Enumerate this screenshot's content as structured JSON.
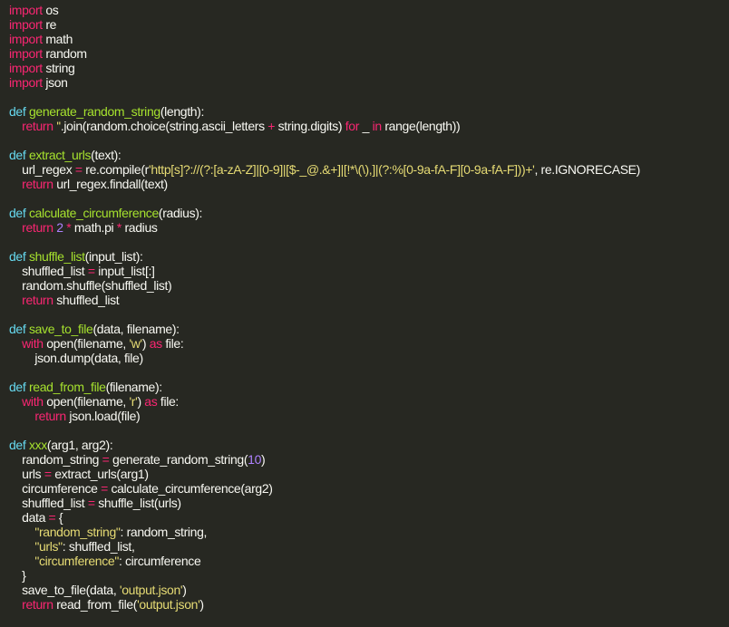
{
  "theme": {
    "background": "#272822",
    "text": "#f8f8f2",
    "keyword": "#f92672",
    "builtin": "#66d9ef",
    "function": "#a6e22e",
    "string": "#e6db74",
    "number": "#ae81ff"
  },
  "code": {
    "lines": [
      [
        [
          "kw",
          "import"
        ],
        [
          "tx",
          " os"
        ]
      ],
      [
        [
          "kw",
          "import"
        ],
        [
          "tx",
          " re"
        ]
      ],
      [
        [
          "kw",
          "import"
        ],
        [
          "tx",
          " math"
        ]
      ],
      [
        [
          "kw",
          "import"
        ],
        [
          "tx",
          " random"
        ]
      ],
      [
        [
          "kw",
          "import"
        ],
        [
          "tx",
          " string"
        ]
      ],
      [
        [
          "kw",
          "import"
        ],
        [
          "tx",
          " json"
        ]
      ],
      [],
      [
        [
          "bi",
          "def"
        ],
        [
          "tx",
          " "
        ],
        [
          "fn",
          "generate_random_string"
        ],
        [
          "tx",
          "(length):"
        ]
      ],
      [
        [
          "tx",
          "    "
        ],
        [
          "kw",
          "return"
        ],
        [
          "tx",
          " "
        ],
        [
          "st",
          "''"
        ],
        [
          "tx",
          ".join(random.choice(string.ascii_letters "
        ],
        [
          "op",
          "+"
        ],
        [
          "tx",
          " string.digits) "
        ],
        [
          "kw",
          "for"
        ],
        [
          "tx",
          " _ "
        ],
        [
          "kw",
          "in"
        ],
        [
          "tx",
          " range(length))"
        ]
      ],
      [],
      [
        [
          "bi",
          "def"
        ],
        [
          "tx",
          " "
        ],
        [
          "fn",
          "extract_urls"
        ],
        [
          "tx",
          "(text):"
        ]
      ],
      [
        [
          "tx",
          "    url_regex "
        ],
        [
          "op",
          "="
        ],
        [
          "tx",
          " re.compile(r"
        ],
        [
          "st",
          "'http[s]?://(?:[a-zA-Z]|[0-9]|[$-_@.&+]|[!*\\(\\),]|(?:%[0-9a-fA-F][0-9a-fA-F]))+'"
        ],
        [
          "tx",
          ", re.IGNORECASE)"
        ]
      ],
      [
        [
          "tx",
          "    "
        ],
        [
          "kw",
          "return"
        ],
        [
          "tx",
          " url_regex.findall(text)"
        ]
      ],
      [],
      [
        [
          "bi",
          "def"
        ],
        [
          "tx",
          " "
        ],
        [
          "fn",
          "calculate_circumference"
        ],
        [
          "tx",
          "(radius):"
        ]
      ],
      [
        [
          "tx",
          "    "
        ],
        [
          "kw",
          "return"
        ],
        [
          "tx",
          " "
        ],
        [
          "nm",
          "2"
        ],
        [
          "tx",
          " "
        ],
        [
          "op",
          "*"
        ],
        [
          "tx",
          " math.pi "
        ],
        [
          "op",
          "*"
        ],
        [
          "tx",
          " radius"
        ]
      ],
      [],
      [
        [
          "bi",
          "def"
        ],
        [
          "tx",
          " "
        ],
        [
          "fn",
          "shuffle_list"
        ],
        [
          "tx",
          "(input_list):"
        ]
      ],
      [
        [
          "tx",
          "    shuffled_list "
        ],
        [
          "op",
          "="
        ],
        [
          "tx",
          " input_list[:]"
        ]
      ],
      [
        [
          "tx",
          "    random.shuffle(shuffled_list)"
        ]
      ],
      [
        [
          "tx",
          "    "
        ],
        [
          "kw",
          "return"
        ],
        [
          "tx",
          " shuffled_list"
        ]
      ],
      [],
      [
        [
          "bi",
          "def"
        ],
        [
          "tx",
          " "
        ],
        [
          "fn",
          "save_to_file"
        ],
        [
          "tx",
          "(data, filename):"
        ]
      ],
      [
        [
          "tx",
          "    "
        ],
        [
          "kw",
          "with"
        ],
        [
          "tx",
          " open(filename, "
        ],
        [
          "st",
          "'w'"
        ],
        [
          "tx",
          ") "
        ],
        [
          "kw",
          "as"
        ],
        [
          "tx",
          " file:"
        ]
      ],
      [
        [
          "tx",
          "        json.dump(data, file)"
        ]
      ],
      [],
      [
        [
          "bi",
          "def"
        ],
        [
          "tx",
          " "
        ],
        [
          "fn",
          "read_from_file"
        ],
        [
          "tx",
          "(filename):"
        ]
      ],
      [
        [
          "tx",
          "    "
        ],
        [
          "kw",
          "with"
        ],
        [
          "tx",
          " open(filename, "
        ],
        [
          "st",
          "'r'"
        ],
        [
          "tx",
          ") "
        ],
        [
          "kw",
          "as"
        ],
        [
          "tx",
          " file:"
        ]
      ],
      [
        [
          "tx",
          "        "
        ],
        [
          "kw",
          "return"
        ],
        [
          "tx",
          " json.load(file)"
        ]
      ],
      [],
      [
        [
          "bi",
          "def"
        ],
        [
          "tx",
          " "
        ],
        [
          "fn",
          "xxx"
        ],
        [
          "tx",
          "(arg1, arg2):"
        ]
      ],
      [
        [
          "tx",
          "    random_string "
        ],
        [
          "op",
          "="
        ],
        [
          "tx",
          " generate_random_string("
        ],
        [
          "nm",
          "10"
        ],
        [
          "tx",
          ")"
        ]
      ],
      [
        [
          "tx",
          "    urls "
        ],
        [
          "op",
          "="
        ],
        [
          "tx",
          " extract_urls(arg1)"
        ]
      ],
      [
        [
          "tx",
          "    circumference "
        ],
        [
          "op",
          "="
        ],
        [
          "tx",
          " calculate_circumference(arg2)"
        ]
      ],
      [
        [
          "tx",
          "    shuffled_list "
        ],
        [
          "op",
          "="
        ],
        [
          "tx",
          " shuffle_list(urls)"
        ]
      ],
      [
        [
          "tx",
          "    data "
        ],
        [
          "op",
          "="
        ],
        [
          "tx",
          " {"
        ]
      ],
      [
        [
          "tx",
          "        "
        ],
        [
          "st",
          "\"random_string\""
        ],
        [
          "tx",
          ": random_string,"
        ]
      ],
      [
        [
          "tx",
          "        "
        ],
        [
          "st",
          "\"urls\""
        ],
        [
          "tx",
          ": shuffled_list,"
        ]
      ],
      [
        [
          "tx",
          "        "
        ],
        [
          "st",
          "\"circumference\""
        ],
        [
          "tx",
          ": circumference"
        ]
      ],
      [
        [
          "tx",
          "    }"
        ]
      ],
      [
        [
          "tx",
          "    save_to_file(data, "
        ],
        [
          "st",
          "'output.json'"
        ],
        [
          "tx",
          ")"
        ]
      ],
      [
        [
          "tx",
          "    "
        ],
        [
          "kw",
          "return"
        ],
        [
          "tx",
          " read_from_file("
        ],
        [
          "st",
          "'output.json'"
        ],
        [
          "tx",
          ")"
        ]
      ]
    ]
  }
}
